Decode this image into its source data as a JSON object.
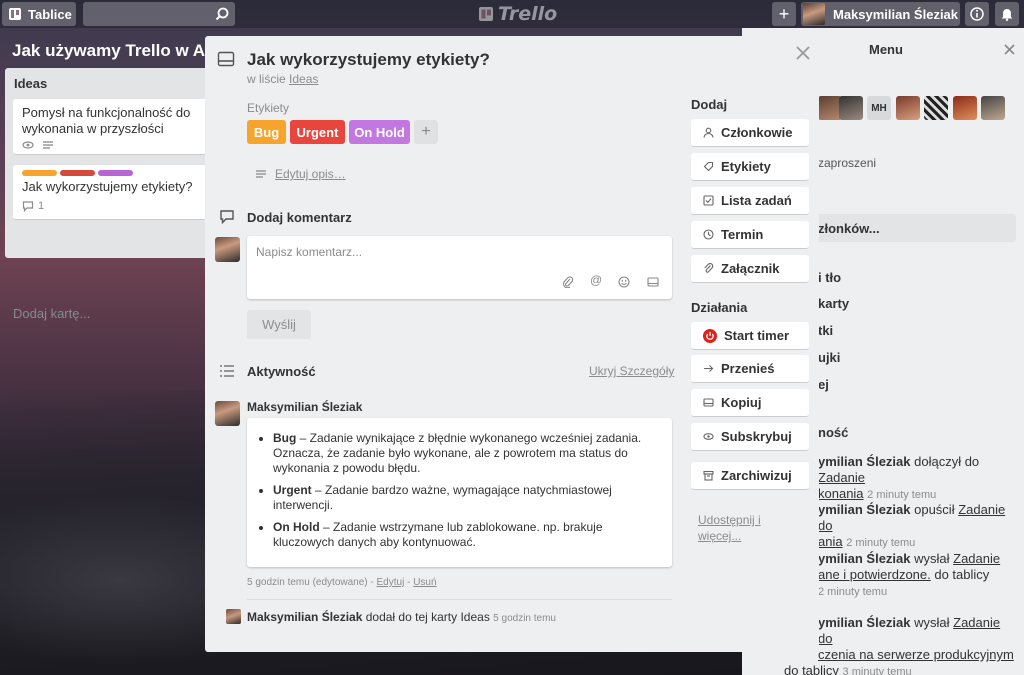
{
  "topbar": {
    "boards_label": "Tablice",
    "logo_text": "Trello",
    "user_name": "Maksymilian Śleziak"
  },
  "board": {
    "name": "Jak używamy Trello w Agencji"
  },
  "list": {
    "title": "Ideas",
    "cards": [
      {
        "title": "Pomysł na funkcjonalność do wykonania w przyszłości"
      },
      {
        "title": "Jak wykorzystujemy etykiety?",
        "comments": "1",
        "labels": [
          "#f6a42c",
          "#d5493a",
          "#b863d6"
        ]
      }
    ],
    "add_card": "Dodaj kartę..."
  },
  "menu": {
    "title": "Menu",
    "avatar_initials": "MH",
    "lines": [
      "zaproszeni",
      "złonków...",
      "i tło",
      "karty",
      "tki",
      "ujki",
      "ej",
      "ność"
    ],
    "activity": [
      {
        "user": "ymilian Śleziak",
        "text": " dołączył do ",
        "link": "Zadanie",
        "link2": "konania",
        "time": "2 minuty temu"
      },
      {
        "user": "ymilian Śleziak",
        "text": " opuścił ",
        "link": "Zadanie do",
        "link2": "ania",
        "time": "2 minuty temu"
      },
      {
        "user": "ymilian Śleziak",
        "text": " wysłał ",
        "link": "Zadanie",
        "link2": "ane i potwierdzone.",
        "after": " do tablicy",
        "time": "2 minuty temu"
      },
      {
        "user": "ymilian Śleziak",
        "text": " wysłał ",
        "link": "Zadanie do",
        "link2": "czenia na serwerze produkcyjnym",
        "after": "do tablicy",
        "time": "3 minuty temu"
      }
    ]
  },
  "card": {
    "title": "Jak wykorzystujemy etykiety?",
    "in_list_prefix": "w liście ",
    "in_list": "Ideas",
    "labels_heading": "Etykiety",
    "labels": [
      {
        "name": "Bug",
        "color": "#f6a42c"
      },
      {
        "name": "Urgent",
        "color": "#e8453c"
      },
      {
        "name": "On Hold",
        "color": "#c377e0"
      }
    ],
    "add_label": "+",
    "edit_desc": "Edytuj opis…",
    "comment_heading": "Dodaj komentarz",
    "comment_placeholder": "Napisz komentarz...",
    "send": "Wyślij",
    "activity_heading": "Aktywność",
    "hide_details": "Ukryj Szczegóły",
    "comment": {
      "author": "Maksymilian Śleziak",
      "items": [
        {
          "term": "Bug",
          "text": " – Zadanie wynikające z błędnie wykonanego wcześniej zadania. Oznacza, że zadanie było wykonane, ale z powrotem ma status do wykonania z powodu błędu."
        },
        {
          "term": "Urgent",
          "text": " – Zadanie bardzo ważne, wymagające natychmiastowej interwencji."
        },
        {
          "term": "On Hold",
          "text": " – Zadanie wstrzymane lub zablokowane. np. brakuje kluczowych danych aby kontynuować."
        }
      ],
      "meta": "5 godzin temu (edytowane) - ",
      "edit": "Edytuj",
      "sep": " - ",
      "delete": "Usuń"
    },
    "log": {
      "user": "Maksymilian Śleziak",
      "text": " dodał do tej karty Ideas",
      "time": "5 godzin temu"
    },
    "add_heading": "Dodaj",
    "add_buttons": [
      "Członkowie",
      "Etykiety",
      "Lista zadań",
      "Termin",
      "Załącznik"
    ],
    "actions_heading": "Działania",
    "action_buttons": [
      "Start timer",
      "Przenieś",
      "Kopiuj",
      "Subskrybuj",
      "Zarchiwizuj"
    ],
    "share": "Udostępnij i więcej..."
  }
}
